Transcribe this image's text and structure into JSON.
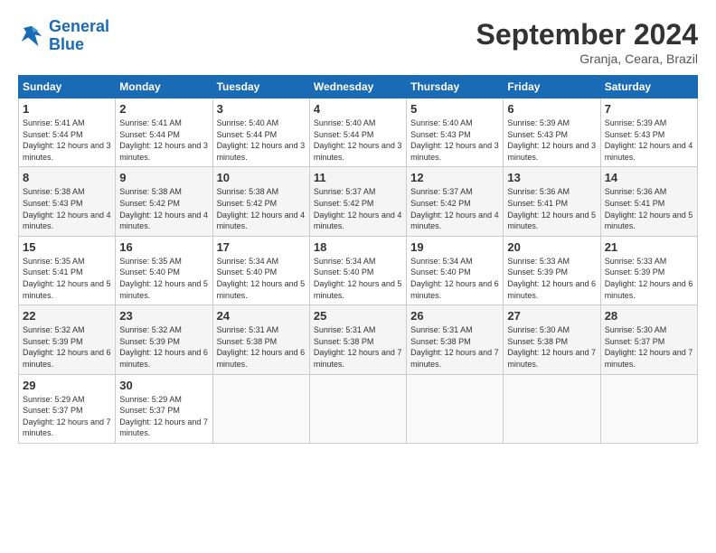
{
  "header": {
    "logo_line1": "General",
    "logo_line2": "Blue",
    "month_title": "September 2024",
    "location": "Granja, Ceara, Brazil"
  },
  "days_of_week": [
    "Sunday",
    "Monday",
    "Tuesday",
    "Wednesday",
    "Thursday",
    "Friday",
    "Saturday"
  ],
  "weeks": [
    [
      {
        "day": "1",
        "sunrise": "5:41 AM",
        "sunset": "5:44 PM",
        "daylight": "12 hours and 3 minutes."
      },
      {
        "day": "2",
        "sunrise": "5:41 AM",
        "sunset": "5:44 PM",
        "daylight": "12 hours and 3 minutes."
      },
      {
        "day": "3",
        "sunrise": "5:40 AM",
        "sunset": "5:44 PM",
        "daylight": "12 hours and 3 minutes."
      },
      {
        "day": "4",
        "sunrise": "5:40 AM",
        "sunset": "5:44 PM",
        "daylight": "12 hours and 3 minutes."
      },
      {
        "day": "5",
        "sunrise": "5:40 AM",
        "sunset": "5:43 PM",
        "daylight": "12 hours and 3 minutes."
      },
      {
        "day": "6",
        "sunrise": "5:39 AM",
        "sunset": "5:43 PM",
        "daylight": "12 hours and 3 minutes."
      },
      {
        "day": "7",
        "sunrise": "5:39 AM",
        "sunset": "5:43 PM",
        "daylight": "12 hours and 4 minutes."
      }
    ],
    [
      {
        "day": "8",
        "sunrise": "5:38 AM",
        "sunset": "5:43 PM",
        "daylight": "12 hours and 4 minutes."
      },
      {
        "day": "9",
        "sunrise": "5:38 AM",
        "sunset": "5:42 PM",
        "daylight": "12 hours and 4 minutes."
      },
      {
        "day": "10",
        "sunrise": "5:38 AM",
        "sunset": "5:42 PM",
        "daylight": "12 hours and 4 minutes."
      },
      {
        "day": "11",
        "sunrise": "5:37 AM",
        "sunset": "5:42 PM",
        "daylight": "12 hours and 4 minutes."
      },
      {
        "day": "12",
        "sunrise": "5:37 AM",
        "sunset": "5:42 PM",
        "daylight": "12 hours and 4 minutes."
      },
      {
        "day": "13",
        "sunrise": "5:36 AM",
        "sunset": "5:41 PM",
        "daylight": "12 hours and 5 minutes."
      },
      {
        "day": "14",
        "sunrise": "5:36 AM",
        "sunset": "5:41 PM",
        "daylight": "12 hours and 5 minutes."
      }
    ],
    [
      {
        "day": "15",
        "sunrise": "5:35 AM",
        "sunset": "5:41 PM",
        "daylight": "12 hours and 5 minutes."
      },
      {
        "day": "16",
        "sunrise": "5:35 AM",
        "sunset": "5:40 PM",
        "daylight": "12 hours and 5 minutes."
      },
      {
        "day": "17",
        "sunrise": "5:34 AM",
        "sunset": "5:40 PM",
        "daylight": "12 hours and 5 minutes."
      },
      {
        "day": "18",
        "sunrise": "5:34 AM",
        "sunset": "5:40 PM",
        "daylight": "12 hours and 5 minutes."
      },
      {
        "day": "19",
        "sunrise": "5:34 AM",
        "sunset": "5:40 PM",
        "daylight": "12 hours and 6 minutes."
      },
      {
        "day": "20",
        "sunrise": "5:33 AM",
        "sunset": "5:39 PM",
        "daylight": "12 hours and 6 minutes."
      },
      {
        "day": "21",
        "sunrise": "5:33 AM",
        "sunset": "5:39 PM",
        "daylight": "12 hours and 6 minutes."
      }
    ],
    [
      {
        "day": "22",
        "sunrise": "5:32 AM",
        "sunset": "5:39 PM",
        "daylight": "12 hours and 6 minutes."
      },
      {
        "day": "23",
        "sunrise": "5:32 AM",
        "sunset": "5:39 PM",
        "daylight": "12 hours and 6 minutes."
      },
      {
        "day": "24",
        "sunrise": "5:31 AM",
        "sunset": "5:38 PM",
        "daylight": "12 hours and 6 minutes."
      },
      {
        "day": "25",
        "sunrise": "5:31 AM",
        "sunset": "5:38 PM",
        "daylight": "12 hours and 7 minutes."
      },
      {
        "day": "26",
        "sunrise": "5:31 AM",
        "sunset": "5:38 PM",
        "daylight": "12 hours and 7 minutes."
      },
      {
        "day": "27",
        "sunrise": "5:30 AM",
        "sunset": "5:38 PM",
        "daylight": "12 hours and 7 minutes."
      },
      {
        "day": "28",
        "sunrise": "5:30 AM",
        "sunset": "5:37 PM",
        "daylight": "12 hours and 7 minutes."
      }
    ],
    [
      {
        "day": "29",
        "sunrise": "5:29 AM",
        "sunset": "5:37 PM",
        "daylight": "12 hours and 7 minutes."
      },
      {
        "day": "30",
        "sunrise": "5:29 AM",
        "sunset": "5:37 PM",
        "daylight": "12 hours and 7 minutes."
      },
      null,
      null,
      null,
      null,
      null
    ]
  ]
}
